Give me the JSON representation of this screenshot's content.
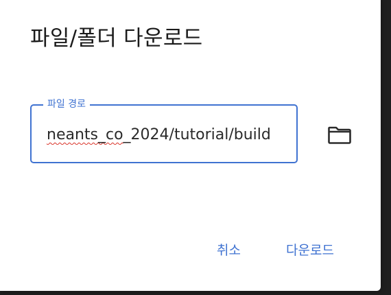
{
  "dialog": {
    "title": "파일/폴더 다운로드",
    "path_field": {
      "label": "파일 경로",
      "value_prefix": "",
      "value_misspelled": "neants_co",
      "value_rest": "_2024/tutorial/build"
    },
    "folder_icon": "folder-icon",
    "actions": {
      "cancel": "취소",
      "download": "다운로드"
    }
  },
  "colors": {
    "accent": "#3f72d1",
    "title": "#1b1b1b",
    "spell_error": "#d93025"
  }
}
